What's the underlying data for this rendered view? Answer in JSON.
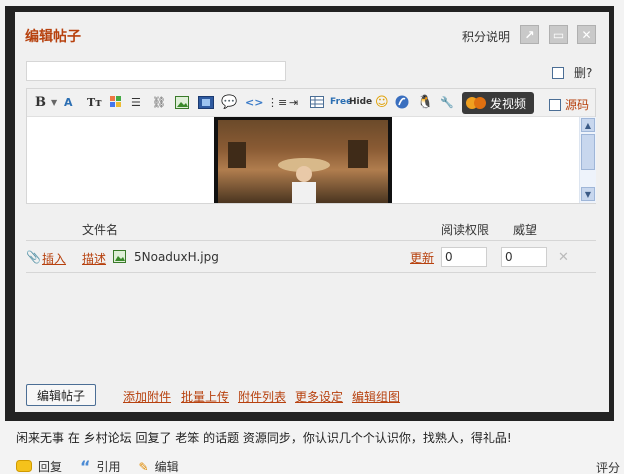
{
  "dialog": {
    "title": "编辑帖子",
    "credits_label": "积分说明",
    "delete_label": "删?",
    "source_label": "源码",
    "video_button_label": "发视频"
  },
  "toolbar": {
    "icons": [
      "bold-icon",
      "dropdown-arrow-icon",
      "font-color-icon",
      "font-size-icon",
      "color-grid-icon",
      "align-icon",
      "link-icon",
      "image-icon",
      "media-icon",
      "quote-icon",
      "code-icon",
      "ordered-list-icon",
      "indent-icon",
      "table-icon",
      "free-icon",
      "hide-icon",
      "smiley-icon",
      "flash-icon",
      "qq-icon",
      "tool-icon"
    ],
    "free_label": "Free",
    "hide_label": "Hide"
  },
  "attachments": {
    "headers": {
      "filename": "文件名",
      "read_perm": "阅读权限",
      "price": "威望"
    },
    "rows": [
      {
        "insert": "插入",
        "describe": "描述",
        "filename": "5NoaduxH.jpg",
        "update": "更新",
        "read_perm": "0",
        "price": "0"
      }
    ]
  },
  "footer": {
    "submit_label": "编辑帖子",
    "links": [
      "添加附件",
      "批量上传",
      "附件列表",
      "更多设定",
      "编辑组图"
    ]
  },
  "background": {
    "status_line": "闲来无事  在  乡村论坛  回复了  老笨  的话题  资源同步，你认识几个个认识你，找熟人，得礼品!",
    "actions": [
      "回复",
      "引用",
      "编辑"
    ],
    "rating_label": "评分"
  },
  "colors": {
    "accent": "#b7410e",
    "frame": "#222222",
    "dialog_bg": "#f0f0f0",
    "button_border": "#4b6e95"
  }
}
